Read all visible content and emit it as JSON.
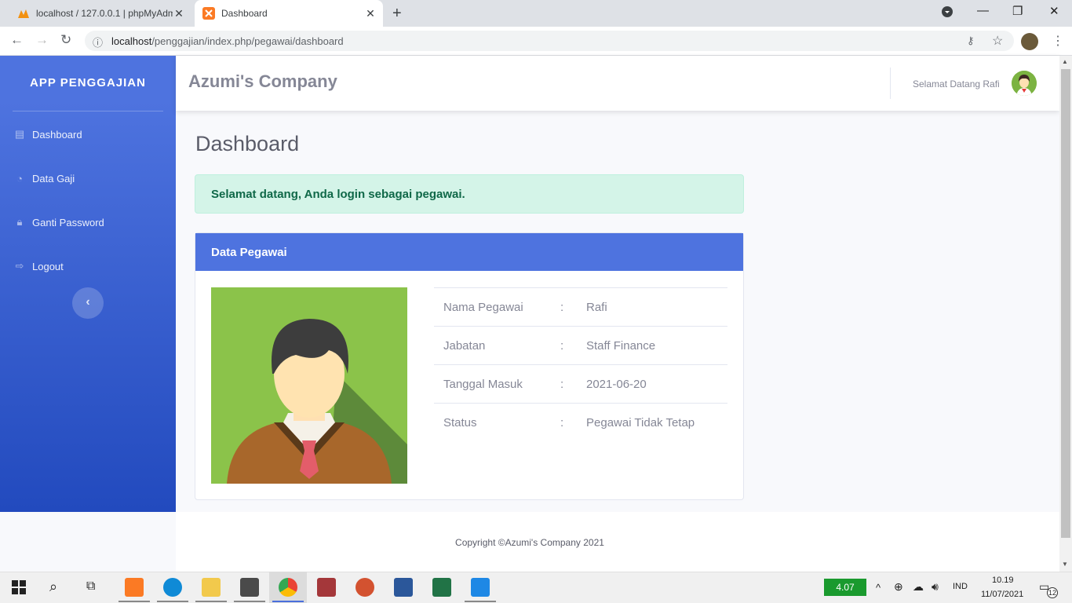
{
  "browser": {
    "tabs": [
      {
        "title": "localhost / 127.0.0.1 | phpMyAdm"
      },
      {
        "title": "Dashboard"
      }
    ],
    "url_host": "localhost",
    "url_path": "/penggajian/index.php/pegawai/dashboard"
  },
  "sidebar": {
    "brand": "APP PENGGAJIAN",
    "items": [
      {
        "label": "Dashboard",
        "icon": "dashboard-icon"
      },
      {
        "label": "Data Gaji",
        "icon": "tachometer-icon"
      },
      {
        "label": "Ganti Password",
        "icon": "lock-icon"
      },
      {
        "label": "Logout",
        "icon": "sign-out-icon"
      }
    ]
  },
  "topbar": {
    "company": "Azumi's Company",
    "welcome": "Selamat Datang Rafi"
  },
  "main": {
    "title": "Dashboard",
    "alert": "Selamat datang, Anda login sebagai pegawai.",
    "card_title": "Data Pegawai",
    "separator": ":",
    "rows": [
      {
        "label": "Nama Pegawai",
        "value": "Rafi"
      },
      {
        "label": "Jabatan",
        "value": "Staff Finance"
      },
      {
        "label": "Tanggal Masuk",
        "value": "2021-06-20"
      },
      {
        "label": "Status",
        "value": "Pegawai Tidak Tetap"
      }
    ]
  },
  "footer": {
    "text": "Copyright ©Azumi's Company 2021"
  },
  "taskbar": {
    "battery": "4.07",
    "lang": "IND",
    "time": "10.19",
    "date": "11/07/2021",
    "notifications": "12"
  },
  "colors": {
    "primary": "#4e73df",
    "alert_bg": "#d4f4e8",
    "alert_text": "#0f6848"
  }
}
